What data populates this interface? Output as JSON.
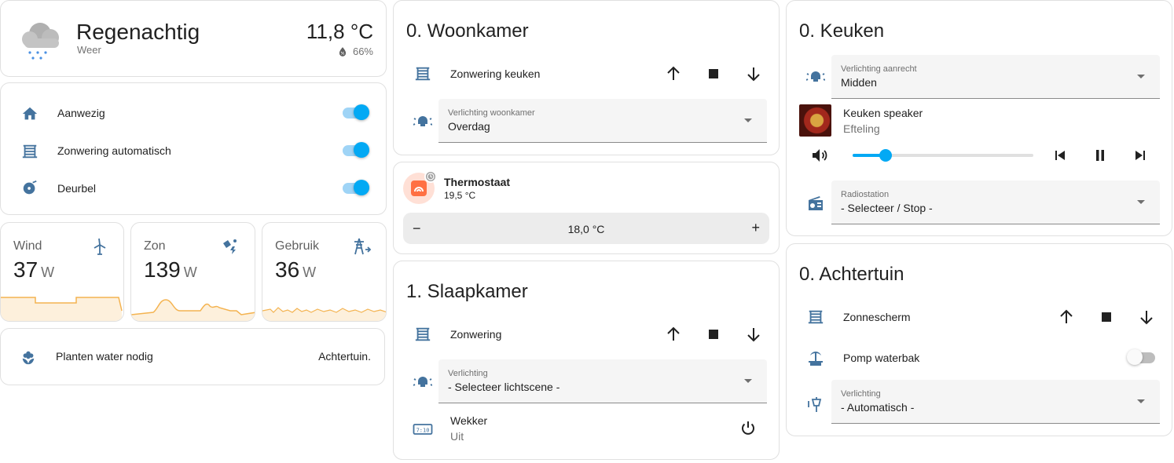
{
  "weather": {
    "condition": "Regenachtig",
    "name": "Weer",
    "temperature": "11,8 °C",
    "humidity": "66%"
  },
  "toggles": {
    "items": [
      {
        "label": "Aanwezig",
        "icon": "home-icon",
        "on": true
      },
      {
        "label": "Zonwering automatisch",
        "icon": "blinds-icon",
        "on": true
      },
      {
        "label": "Deurbel",
        "icon": "bell-icon",
        "on": true
      }
    ]
  },
  "stats": [
    {
      "label": "Wind",
      "value": "37",
      "unit": "W",
      "icon": "wind-turbine-icon"
    },
    {
      "label": "Zon",
      "value": "139",
      "unit": "W",
      "icon": "solar-power-icon"
    },
    {
      "label": "Gebruik",
      "value": "36",
      "unit": "W",
      "icon": "transmission-tower-icon"
    }
  ],
  "plants": {
    "label": "Planten water nodig",
    "value": "Achtertuin."
  },
  "woonkamer": {
    "title": "0. Woonkamer",
    "cover_label": "Zonwering keuken",
    "light_select_label": "Verlichting woonkamer",
    "light_select_value": "Overdag"
  },
  "thermostat": {
    "name": "Thermostaat",
    "current": "19,5 °C",
    "target": "18,0 °C",
    "minus": "−",
    "plus": "+"
  },
  "slaapkamer": {
    "title": "1. Slaapkamer",
    "cover_label": "Zonwering",
    "light_select_label": "Verlichting",
    "light_select_value": "- Selecteer lichtscene -",
    "alarm_label": "Wekker",
    "alarm_state": "Uit"
  },
  "keuken": {
    "title": "0. Keuken",
    "light_select_label": "Verlichting aanrecht",
    "light_select_value": "Midden",
    "speaker_name": "Keuken speaker",
    "speaker_source": "Efteling",
    "volume_level": 0.14,
    "radio_select_label": "Radiostation",
    "radio_select_value": "- Selecteer / Stop -"
  },
  "achtertuin": {
    "title": "0. Achtertuin",
    "cover_label": "Zonnescherm",
    "pump_label": "Pomp waterbak",
    "pump_on": false,
    "light_select_label": "Verlichting",
    "light_select_value": "- Automatisch -"
  },
  "colors": {
    "accent": "#03a9f4",
    "icon": "#44739e",
    "graph": "#f4b350",
    "graph_fill": "#fdf0dc",
    "thermostat": "#ff7043"
  }
}
